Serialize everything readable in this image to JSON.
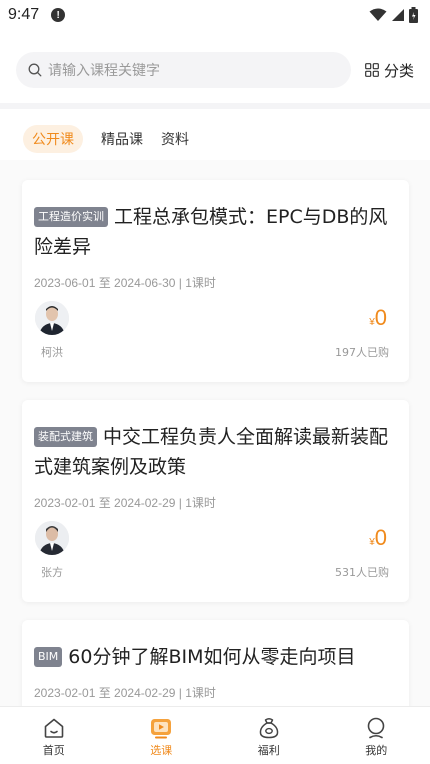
{
  "status_bar": {
    "time": "9:47",
    "notification_glyph": "!"
  },
  "search": {
    "placeholder": "请输入课程关键字"
  },
  "category_button": {
    "label": "分类"
  },
  "tabs": [
    {
      "label": "公开课",
      "active": true
    },
    {
      "label": "精品课",
      "active": false
    },
    {
      "label": "资料",
      "active": false
    }
  ],
  "courses": [
    {
      "tag": "工程造价实训",
      "title": "工程总承包模式：EPC与DB的风险差异",
      "meta": "2023-06-01 至 2024-06-30 | 1课时",
      "teacher": "柯洪",
      "price_symbol": "¥",
      "price": "0",
      "buyers": "197人已购"
    },
    {
      "tag": "装配式建筑",
      "title": "中交工程负责人全面解读最新装配式建筑案例及政策",
      "meta": "2023-02-01 至 2024-02-29 | 1课时",
      "teacher": "张方",
      "price_symbol": "¥",
      "price": "0",
      "buyers": "531人已购"
    },
    {
      "tag": "BIM",
      "title": "60分钟了解BIM如何从零走向项目",
      "meta": "2023-02-01 至 2024-02-29 | 1课时"
    }
  ],
  "bottom_nav": [
    {
      "label": "首页",
      "icon": "home-icon",
      "active": false
    },
    {
      "label": "选课",
      "icon": "play-course-icon",
      "active": true
    },
    {
      "label": "福利",
      "icon": "gift-bag-icon",
      "active": false
    },
    {
      "label": "我的",
      "icon": "profile-icon",
      "active": false
    }
  ],
  "colors": {
    "accent": "#f08a1c",
    "tag_bg": "#7f838f",
    "tab_active_bg": "#fdf0e1"
  }
}
